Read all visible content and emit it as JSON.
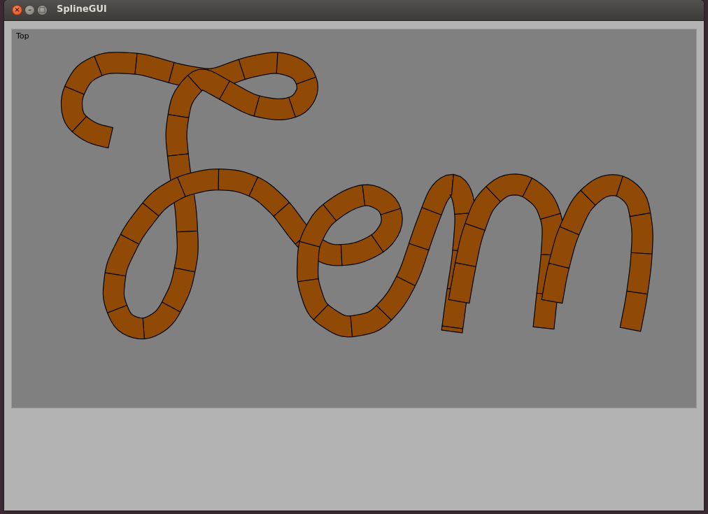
{
  "window": {
    "title": "SplineGUI",
    "buttons": {
      "close_glyph": "×",
      "minimize_glyph": "–",
      "maximize_glyph": "□"
    }
  },
  "viewport": {
    "label": "Top",
    "background_color": "#808080"
  },
  "spline": {
    "fill_color": "#914a05",
    "stroke_color": "#000000"
  }
}
